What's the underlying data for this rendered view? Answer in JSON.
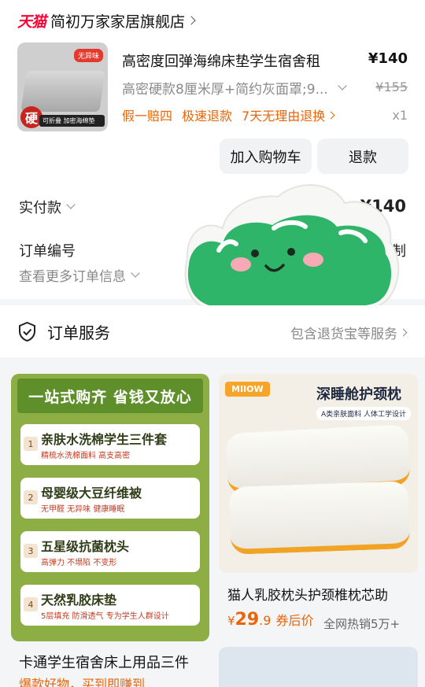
{
  "store": {
    "platform_logo": "天猫",
    "name": "简初万家家居旗舰店"
  },
  "product": {
    "title": "高密度回弹海绵床垫学生宿舍租",
    "price": "¥140",
    "spec": "高密硬款8厘米厚+简约灰面罩;9...",
    "original_price": "¥155",
    "promos": [
      "假一赔四",
      "极速退款",
      "7天无理由退换"
    ],
    "quantity": "x1",
    "thumb_tag": "无异味",
    "thumb_seal": "硬",
    "thumb_strip": "可折叠 加密海绵垫"
  },
  "actions": {
    "add_to_cart": "加入购物车",
    "refund": "退款"
  },
  "payment": {
    "label": "实付款",
    "amount": "¥140"
  },
  "order": {
    "number_label": "订单编号",
    "copy": "复制",
    "more_info": "查看更多订单信息"
  },
  "service": {
    "title": "订单服务",
    "desc": "包含退货宝等服务"
  },
  "recommend_left": {
    "banner": "一站式购齐 省钱又放心",
    "features": [
      {
        "num": "1",
        "title": "亲肤水洗棉学生三件套",
        "sub": "精梳水洗棉面料 高支高密"
      },
      {
        "num": "2",
        "title": "母婴级大豆纤维被",
        "sub": "无甲醛 无异味 健康睡眠"
      },
      {
        "num": "3",
        "title": "五星级抗菌枕头",
        "sub": "高弹力 不塌陷 不变形"
      },
      {
        "num": "4",
        "title": "天然乳胶床垫",
        "sub": "5层填充 防滑透气 专为学生人群设计"
      }
    ],
    "title": "卡通学生宿舍床上用品三件",
    "subtitle": "爆款好物，买到即赚到"
  },
  "recommend_right": {
    "brand": "MIIOW",
    "headline": "深睡舱护颈枕",
    "badge": "A类亲肤面料 人体工学设计",
    "title": "猫人乳胶枕头护颈椎枕芯助",
    "price_currency": "¥",
    "price_int": "29",
    "price_dec": ".9",
    "price_note": "券后价",
    "sales": "全网热销5万+"
  }
}
